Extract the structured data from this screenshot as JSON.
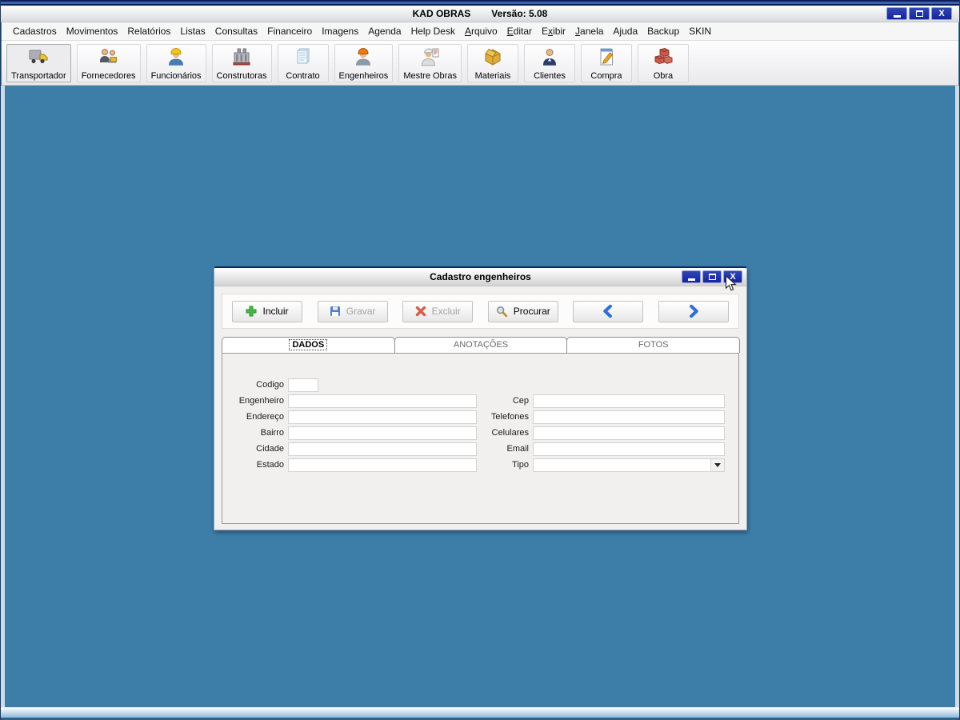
{
  "window": {
    "title": "KAD OBRAS",
    "version_label": "Versão: 5.08",
    "close_glyph": "X"
  },
  "menu": {
    "items": [
      {
        "label": "Cadastros",
        "underline": -1
      },
      {
        "label": "Movimentos",
        "underline": -1
      },
      {
        "label": "Relatórios",
        "underline": -1
      },
      {
        "label": "Listas",
        "underline": -1
      },
      {
        "label": "Consultas",
        "underline": -1
      },
      {
        "label": "Financeiro",
        "underline": -1
      },
      {
        "label": "Imagens",
        "underline": -1
      },
      {
        "label": "Agenda",
        "underline": -1
      },
      {
        "label": "Help Desk",
        "underline": -1
      },
      {
        "label": "Arquivo",
        "underline": 0
      },
      {
        "label": "Editar",
        "underline": 0
      },
      {
        "label": "Exibir",
        "underline": 1
      },
      {
        "label": "Janela",
        "underline": 0
      },
      {
        "label": "Ajuda",
        "underline": -1
      },
      {
        "label": "Backup",
        "underline": -1
      },
      {
        "label": "SKIN",
        "underline": -1
      }
    ]
  },
  "toolbar": {
    "buttons": [
      {
        "label": "Transportador",
        "icon": "truck-icon"
      },
      {
        "label": "Fornecedores",
        "icon": "suppliers-icon"
      },
      {
        "label": "Funcionários",
        "icon": "worker-icon"
      },
      {
        "label": "Construtoras",
        "icon": "building-icon"
      },
      {
        "label": "Contrato",
        "icon": "document-icon"
      },
      {
        "label": "Engenheiros",
        "icon": "engineer-icon"
      },
      {
        "label": "Mestre Obras",
        "icon": "foreman-icon"
      },
      {
        "label": "Materiais",
        "icon": "box-icon"
      },
      {
        "label": "Clientes",
        "icon": "client-icon"
      },
      {
        "label": "Compra",
        "icon": "purchase-icon"
      },
      {
        "label": "Obra",
        "icon": "bricks-icon"
      }
    ]
  },
  "dialog": {
    "title": "Cadastro engenheiros",
    "actions": {
      "incluir": "Incluir",
      "gravar": "Gravar",
      "excluir": "Excluir",
      "procurar": "Procurar"
    },
    "tabs": [
      {
        "label": "DADOS"
      },
      {
        "label": "ANOTAÇÕES"
      },
      {
        "label": "FOTOS"
      }
    ],
    "form": {
      "left": [
        {
          "label": "Codigo",
          "value": ""
        },
        {
          "label": "Engenheiro",
          "value": ""
        },
        {
          "label": "Endereço",
          "value": ""
        },
        {
          "label": "Bairro",
          "value": ""
        },
        {
          "label": "Cidade",
          "value": ""
        },
        {
          "label": "Estado",
          "value": ""
        }
      ],
      "right": [
        {
          "label": "Cep",
          "value": ""
        },
        {
          "label": "Telefones",
          "value": ""
        },
        {
          "label": "Celulares",
          "value": ""
        },
        {
          "label": "Email",
          "value": ""
        },
        {
          "label": "Tipo",
          "value": ""
        }
      ]
    }
  },
  "colors": {
    "desktop_blue": "#3d7ea9",
    "navy_control": "#15249a",
    "green_plus": "#46b846",
    "red_delete": "#d03a22",
    "blue_nav": "#2f6fd6"
  }
}
